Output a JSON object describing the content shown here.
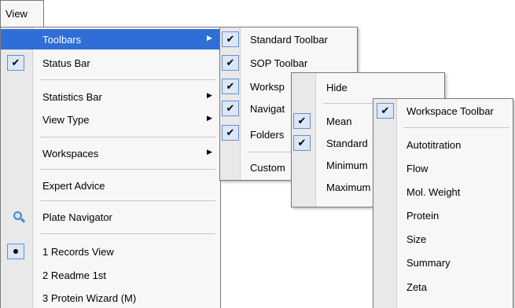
{
  "menubar": {
    "view": "View"
  },
  "main_menu": {
    "toolbars": "Toolbars",
    "status_bar": "Status Bar",
    "statistics_bar": "Statistics Bar",
    "view_type": "View Type",
    "workspaces": "Workspaces",
    "expert_advice": "Expert Advice",
    "plate_navigator": "Plate Navigator",
    "records_view": "1 Records View",
    "readme": "2 Readme 1st",
    "protein_wizard": "3 Protein Wizard (M)"
  },
  "toolbars_menu": {
    "standard": "Standard Toolbar",
    "sop": "SOP Toolbar",
    "workspace": "Worksp",
    "navigator": "Navigat",
    "folders": "Folders",
    "customize": "Custom"
  },
  "statistics_menu": {
    "hide": "Hide",
    "mean": "Mean",
    "standard": "Standard",
    "minimum": "Minimum",
    "maximum": "Maximum"
  },
  "workspaces_menu": {
    "workspace_toolbar": "Workspace Toolbar",
    "items": [
      "Autotitration",
      "Flow",
      "Mol. Weight",
      "Protein",
      "Size",
      "Summary",
      "Zeta"
    ]
  },
  "glyphs": {
    "check": "✔",
    "arrow": "▶"
  }
}
